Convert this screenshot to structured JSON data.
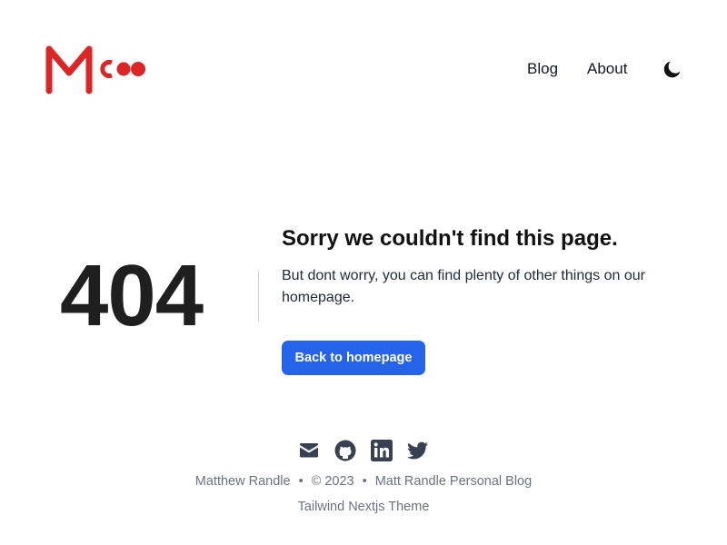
{
  "colors": {
    "brand_red": "#dc2626",
    "button_blue": "#2563eb",
    "icon_gray": "#374151",
    "footer_text": "#6b7280"
  },
  "header": {
    "logo_icon": "m-logo-icon",
    "nav": [
      {
        "label": "Blog"
      },
      {
        "label": "About"
      }
    ],
    "theme_toggle_icon": "moon-icon"
  },
  "main": {
    "code": "404",
    "title": "Sorry we couldn't find this page.",
    "message": "But dont worry, you can find plenty of other things on our homepage.",
    "button_label": "Back to homepage"
  },
  "footer": {
    "social_icons": [
      "mail-icon",
      "github-icon",
      "linkedin-icon",
      "twitter-icon"
    ],
    "author": "Matthew Randle",
    "separator": "•",
    "copyright": "© 2023",
    "site_title": "Matt Randle Personal Blog",
    "theme_credit": "Tailwind Nextjs Theme"
  }
}
